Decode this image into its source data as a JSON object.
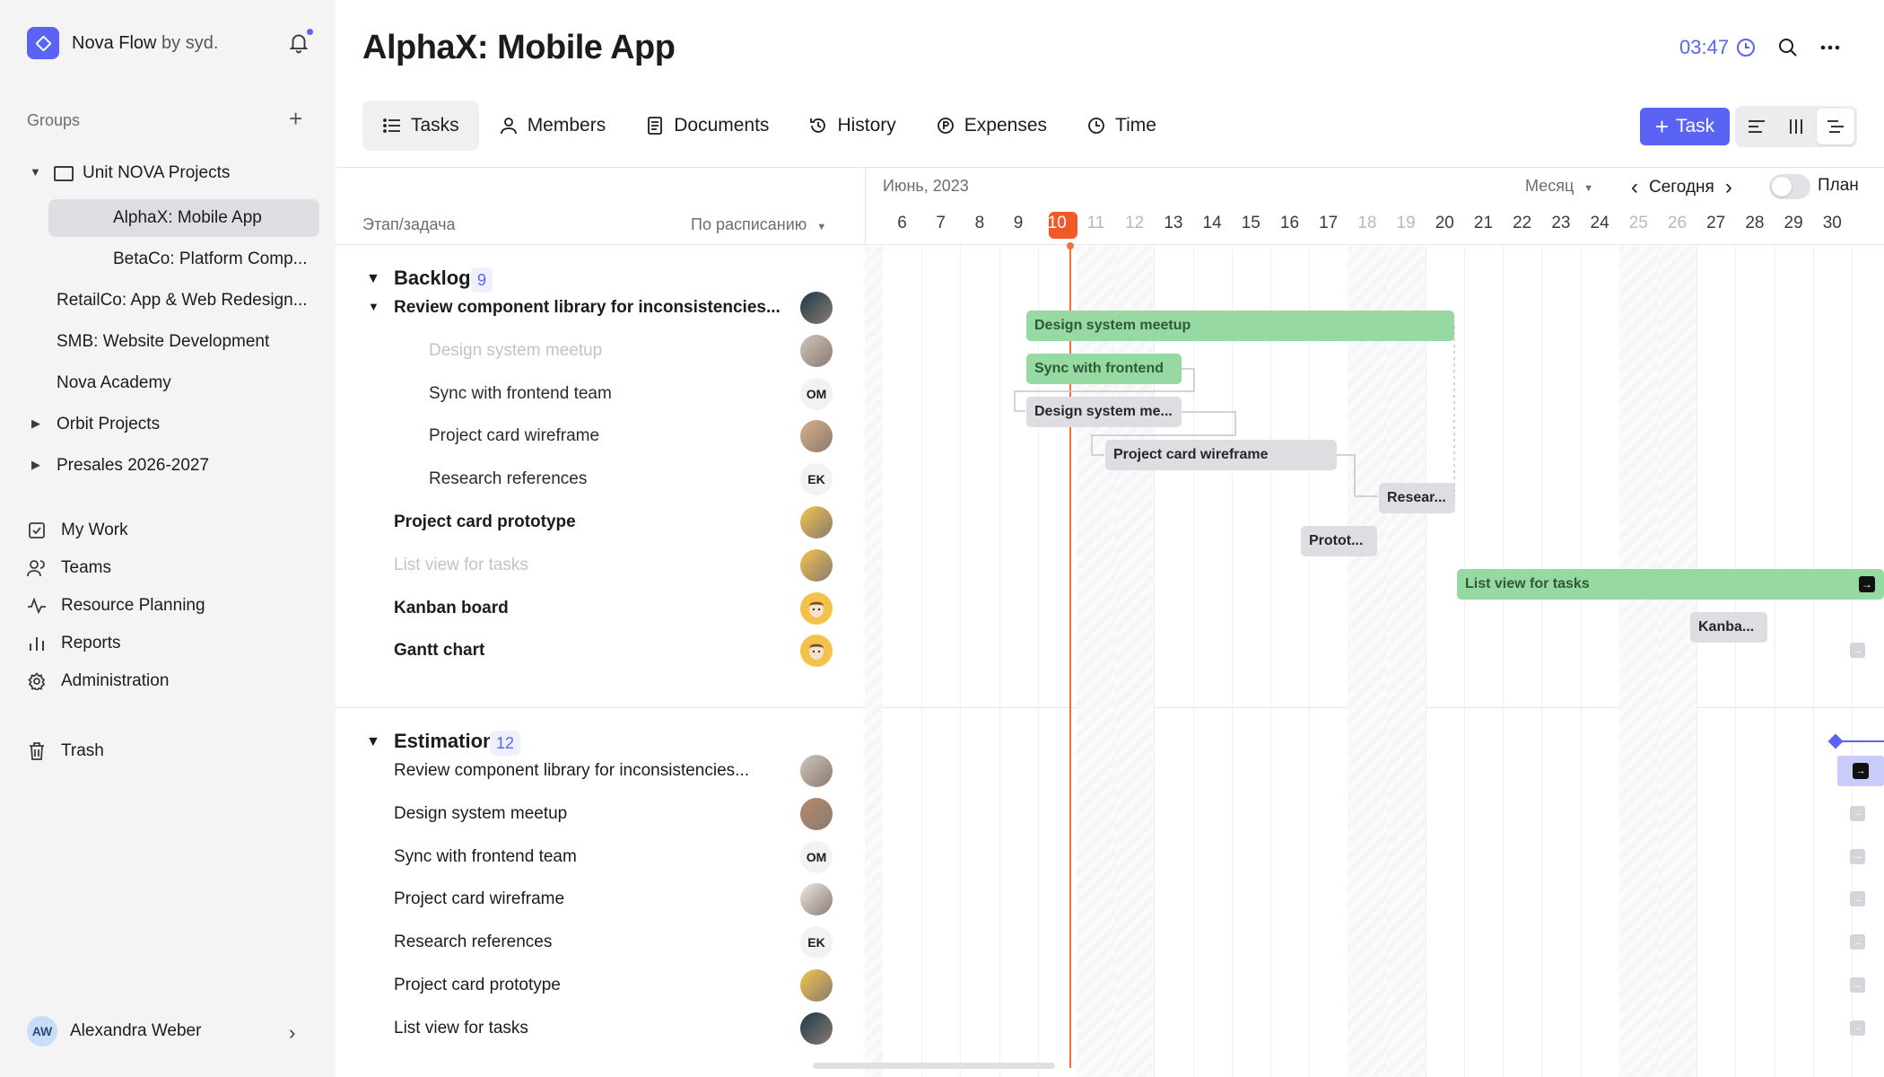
{
  "brand": {
    "name": "Nova Flow",
    "by": "by syd."
  },
  "sidebar": {
    "groups_label": "Groups",
    "tree": [
      {
        "label": "Unit NOVA Projects",
        "expanded": true
      },
      {
        "label": "AlphaX: Mobile App",
        "selected": true
      },
      {
        "label": "BetaCo: Platform Comp..."
      },
      {
        "label": "RetailCo: App & Web Redesign..."
      },
      {
        "label": "SMB: Website Development"
      },
      {
        "label": "Nova Academy"
      },
      {
        "label": "Orbit Projects",
        "collapsed": true
      },
      {
        "label": "Presales 2026-2027",
        "collapsed": true
      }
    ],
    "nav": [
      {
        "label": "My Work",
        "icon": "checkbox-icon"
      },
      {
        "label": "Teams",
        "icon": "users-icon"
      },
      {
        "label": "Resource Planning",
        "icon": "pulse-icon"
      },
      {
        "label": "Reports",
        "icon": "bar-chart-icon"
      },
      {
        "label": "Administration",
        "icon": "gear-icon"
      }
    ],
    "trash": "Trash",
    "user": {
      "initials": "AW",
      "name": "Alexandra Weber"
    }
  },
  "header": {
    "title": "AlphaX: Mobile App",
    "timer": "03:47"
  },
  "tabs": [
    {
      "label": "Tasks",
      "icon": "list-icon",
      "active": true
    },
    {
      "label": "Members",
      "icon": "person-icon"
    },
    {
      "label": "Documents",
      "icon": "document-icon"
    },
    {
      "label": "History",
      "icon": "history-icon"
    },
    {
      "label": "Expenses",
      "icon": "coin-icon"
    },
    {
      "label": "Time",
      "icon": "clock-icon"
    }
  ],
  "task_button": "Task",
  "list_header": {
    "stage": "Этап/задача",
    "sort": "По расписанию"
  },
  "timeline": {
    "month": "Июнь, 2023",
    "scale": "Месяц",
    "today": "Сегодня",
    "plan": "План",
    "days": [
      "6",
      "7",
      "8",
      "9",
      "10",
      "11",
      "12",
      "13",
      "14",
      "15",
      "16",
      "17",
      "18",
      "19",
      "20",
      "21",
      "22",
      "23",
      "24",
      "25",
      "26",
      "27",
      "28",
      "29",
      "30"
    ],
    "weekend_days": [
      "11",
      "12",
      "18",
      "19",
      "25",
      "26"
    ],
    "today_day": "10"
  },
  "groups": [
    {
      "title": "Backlog",
      "count": "9",
      "rows": [
        {
          "label": "Review component library for inconsistencies...",
          "style": "bold",
          "caret": true,
          "avatar": "photo"
        },
        {
          "label": "Design system meetup",
          "style": "muted",
          "avatar": "photo"
        },
        {
          "label": "Sync with frontend team",
          "style": "sub",
          "avatar": "OM"
        },
        {
          "label": "Project card wireframe",
          "style": "sub",
          "avatar": "photo"
        },
        {
          "label": "Research references",
          "style": "sub",
          "avatar": "EK"
        },
        {
          "label": "Project card prototype",
          "style": "bold",
          "avatar": "photo"
        },
        {
          "label": "List view for tasks",
          "style": "muted",
          "avatar": "photo"
        },
        {
          "label": "Kanban board",
          "style": "bold",
          "avatar": "emoji"
        },
        {
          "label": "Gantt chart",
          "style": "bold",
          "avatar": "emoji"
        }
      ]
    },
    {
      "title": "Estimation",
      "count": "12",
      "rows": [
        {
          "label": "Review component library for inconsistencies...",
          "avatar": "photo"
        },
        {
          "label": "Design system meetup",
          "avatar": "photo"
        },
        {
          "label": "Sync with frontend team",
          "avatar": "OM"
        },
        {
          "label": "Project card wireframe",
          "avatar": "photo"
        },
        {
          "label": "Research references",
          "avatar": "EK"
        },
        {
          "label": "Project card prototype",
          "avatar": "photo"
        },
        {
          "label": "List view for tasks",
          "avatar": "photo"
        }
      ]
    }
  ],
  "bars": [
    {
      "label": "Design system meetup",
      "color": "green"
    },
    {
      "label": "Sync with frontend",
      "color": "green"
    },
    {
      "label": "Design system me...",
      "color": "gray"
    },
    {
      "label": "Project card wireframe",
      "color": "gray"
    },
    {
      "label": "Resear...",
      "color": "gray"
    },
    {
      "label": "Protot...",
      "color": "gray"
    },
    {
      "label": "List view for tasks",
      "color": "green"
    },
    {
      "label": "Kanba...",
      "color": "gray"
    }
  ],
  "colors": {
    "accent": "#5b63f5",
    "today": "#f05a28",
    "bar_green": "#96d9a2",
    "bar_gray": "#dddde2"
  }
}
